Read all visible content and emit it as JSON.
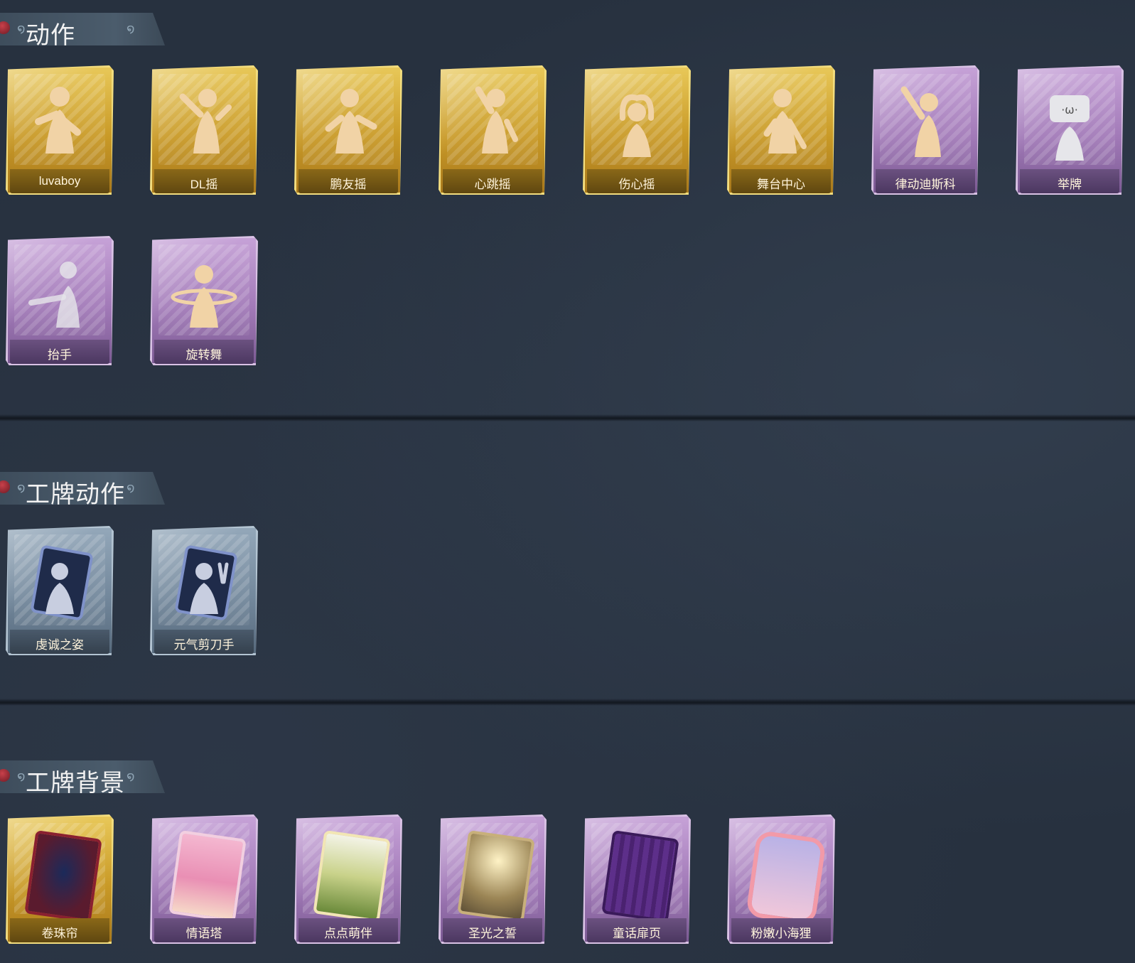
{
  "sections": [
    {
      "title": "动作",
      "items": [
        {
          "label": "luvaboy",
          "rarity": "gold",
          "icon": "dance-pose-icon"
        },
        {
          "label": "DL摇",
          "rarity": "gold",
          "icon": "dance-pose-icon"
        },
        {
          "label": "鹏友摇",
          "rarity": "gold",
          "icon": "dance-pose-icon"
        },
        {
          "label": "心跳摇",
          "rarity": "gold",
          "icon": "dance-pose-icon"
        },
        {
          "label": "伤心摇",
          "rarity": "gold",
          "icon": "heart-hands-pose-icon"
        },
        {
          "label": "舞台中心",
          "rarity": "gold",
          "icon": "dance-pose-icon"
        },
        {
          "label": "律动迪斯科",
          "rarity": "purple",
          "icon": "disco-pose-icon"
        },
        {
          "label": "举牌",
          "rarity": "purple",
          "icon": "sign-raise-icon"
        },
        {
          "label": "抬手",
          "rarity": "purple",
          "icon": "hand-raise-icon"
        },
        {
          "label": "旋转舞",
          "rarity": "purple",
          "icon": "spin-dance-icon"
        }
      ]
    },
    {
      "title": "工牌动作",
      "items": [
        {
          "label": "虔诚之姿",
          "rarity": "blue",
          "icon": "badge-pose-icon"
        },
        {
          "label": "元气剪刀手",
          "rarity": "blue",
          "icon": "badge-peace-sign-icon"
        }
      ]
    },
    {
      "title": "工牌背景",
      "items": [
        {
          "label": "卷珠帘",
          "rarity": "gold",
          "icon": "curtain-card-icon"
        },
        {
          "label": "情语塔",
          "rarity": "purple",
          "icon": "tower-card-icon"
        },
        {
          "label": "点点萌伴",
          "rarity": "purple",
          "icon": "meadow-card-icon"
        },
        {
          "label": "圣光之誓",
          "rarity": "purple",
          "icon": "holy-light-card-icon"
        },
        {
          "label": "童话扉页",
          "rarity": "purple",
          "icon": "storybook-card-icon"
        },
        {
          "label": "粉嫩小海狸",
          "rarity": "purple",
          "icon": "pink-beaver-card-icon"
        }
      ]
    }
  ]
}
